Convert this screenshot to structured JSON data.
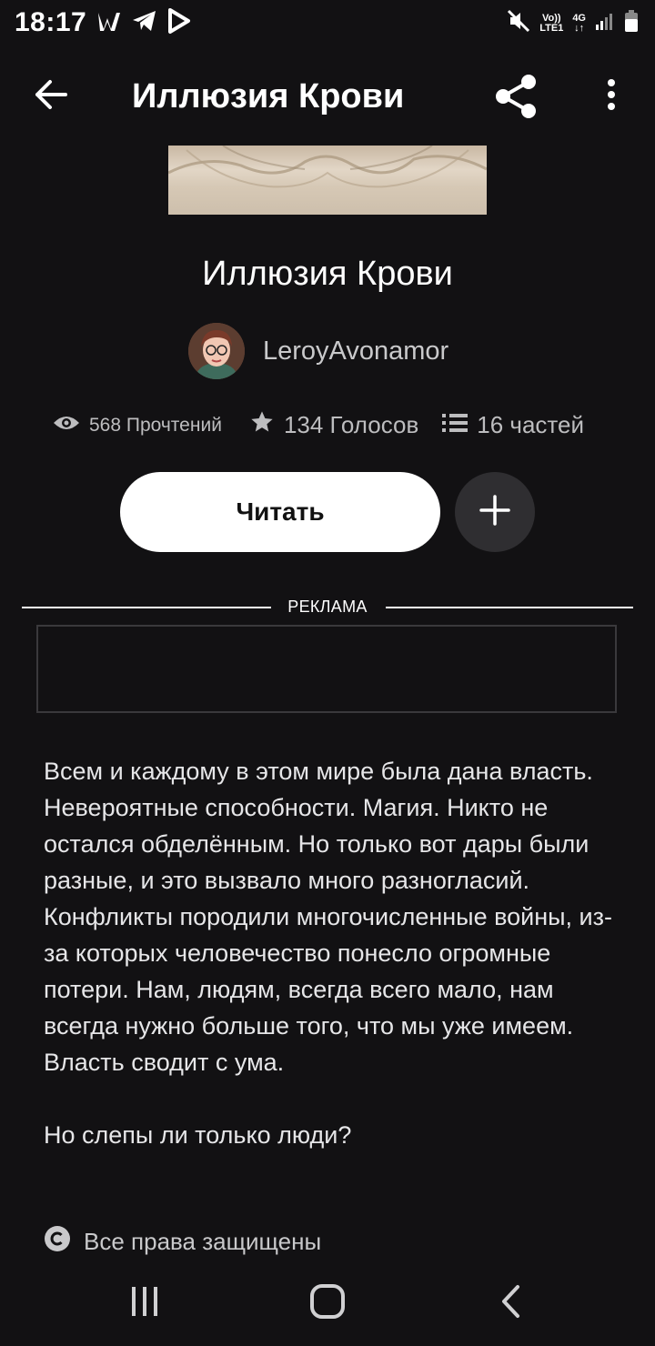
{
  "status_bar": {
    "time": "18:17",
    "network_volte": "Vo))",
    "network_lte": "LTE1",
    "network_gen": "4G"
  },
  "header": {
    "title": "Иллюзия Крови"
  },
  "book": {
    "title": "Иллюзия Крови",
    "author": "LeroyAvonamor",
    "reads": "568 Прочтений",
    "votes": "134 Голосов",
    "parts": "16 частей"
  },
  "actions": {
    "read_label": "Читать"
  },
  "ad": {
    "label": "РЕКЛАМА"
  },
  "description": {
    "text": "Всем и каждому в этом мире была дана власть. Невероятные способности. Магия. Никто не остался обделённым. Но только вот дары были разные, и это вызвало много разногласий. Конфликты породили многочисленные войны, из-за которых человечество понесло огромные потери. Нам, людям, всегда всего мало, нам всегда нужно больше того, что мы уже имеем. Власть сводит с ума.\n\nНо слепы ли только люди?",
    "copyright": "Все права защищены"
  },
  "icons": {
    "back": "arrow-left-icon",
    "share": "share-icon",
    "more": "more-vertical-icon",
    "eye": "eye-icon",
    "star": "star-icon",
    "list": "list-icon",
    "plus": "plus-icon",
    "copyright": "copyright-icon"
  },
  "colors": {
    "background": "#121113",
    "primary_button": "#ffffff",
    "secondary_button": "#2f2e31",
    "muted_text": "#bdbdbf"
  }
}
